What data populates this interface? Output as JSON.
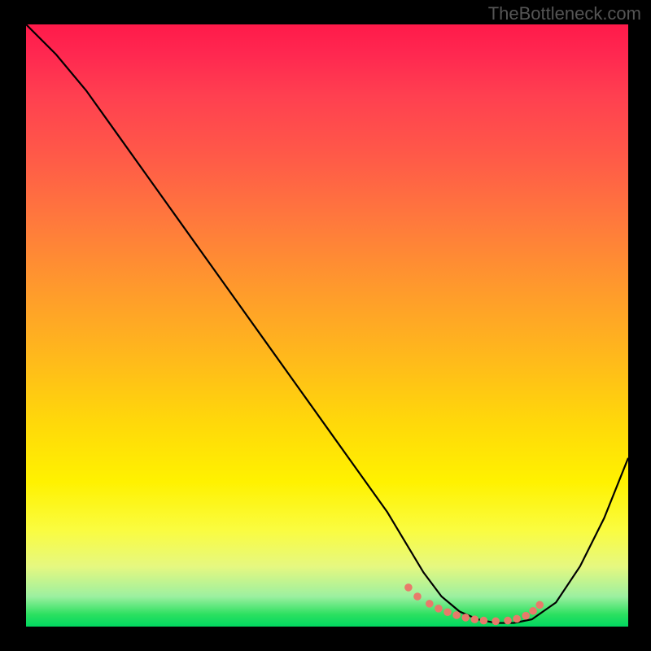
{
  "watermark": "TheBottleneck.com",
  "chart_data": {
    "type": "line",
    "title": "",
    "xlabel": "",
    "ylabel": "",
    "xlim": [
      0,
      100
    ],
    "ylim": [
      0,
      100
    ],
    "series": [
      {
        "name": "curve",
        "x": [
          0,
          5,
          10,
          15,
          20,
          25,
          30,
          35,
          40,
          45,
          50,
          55,
          60,
          63,
          66,
          69,
          72,
          75,
          78,
          81,
          84,
          88,
          92,
          96,
          100
        ],
        "y": [
          100,
          95,
          89,
          82,
          75,
          68,
          61,
          54,
          47,
          40,
          33,
          26,
          19,
          14,
          9,
          5,
          2.5,
          1.2,
          0.6,
          0.6,
          1.2,
          4,
          10,
          18,
          28
        ]
      }
    ],
    "markers": {
      "name": "dots",
      "x": [
        63.5,
        65,
        67,
        68.5,
        70,
        71.5,
        73,
        74.5,
        76,
        78,
        80,
        81.5,
        83,
        84.2,
        85.3
      ],
      "y": [
        6.5,
        5.0,
        3.8,
        3.0,
        2.4,
        1.9,
        1.5,
        1.2,
        1.0,
        0.9,
        1.0,
        1.3,
        1.8,
        2.6,
        3.6
      ],
      "color": "#e87a6a"
    }
  }
}
